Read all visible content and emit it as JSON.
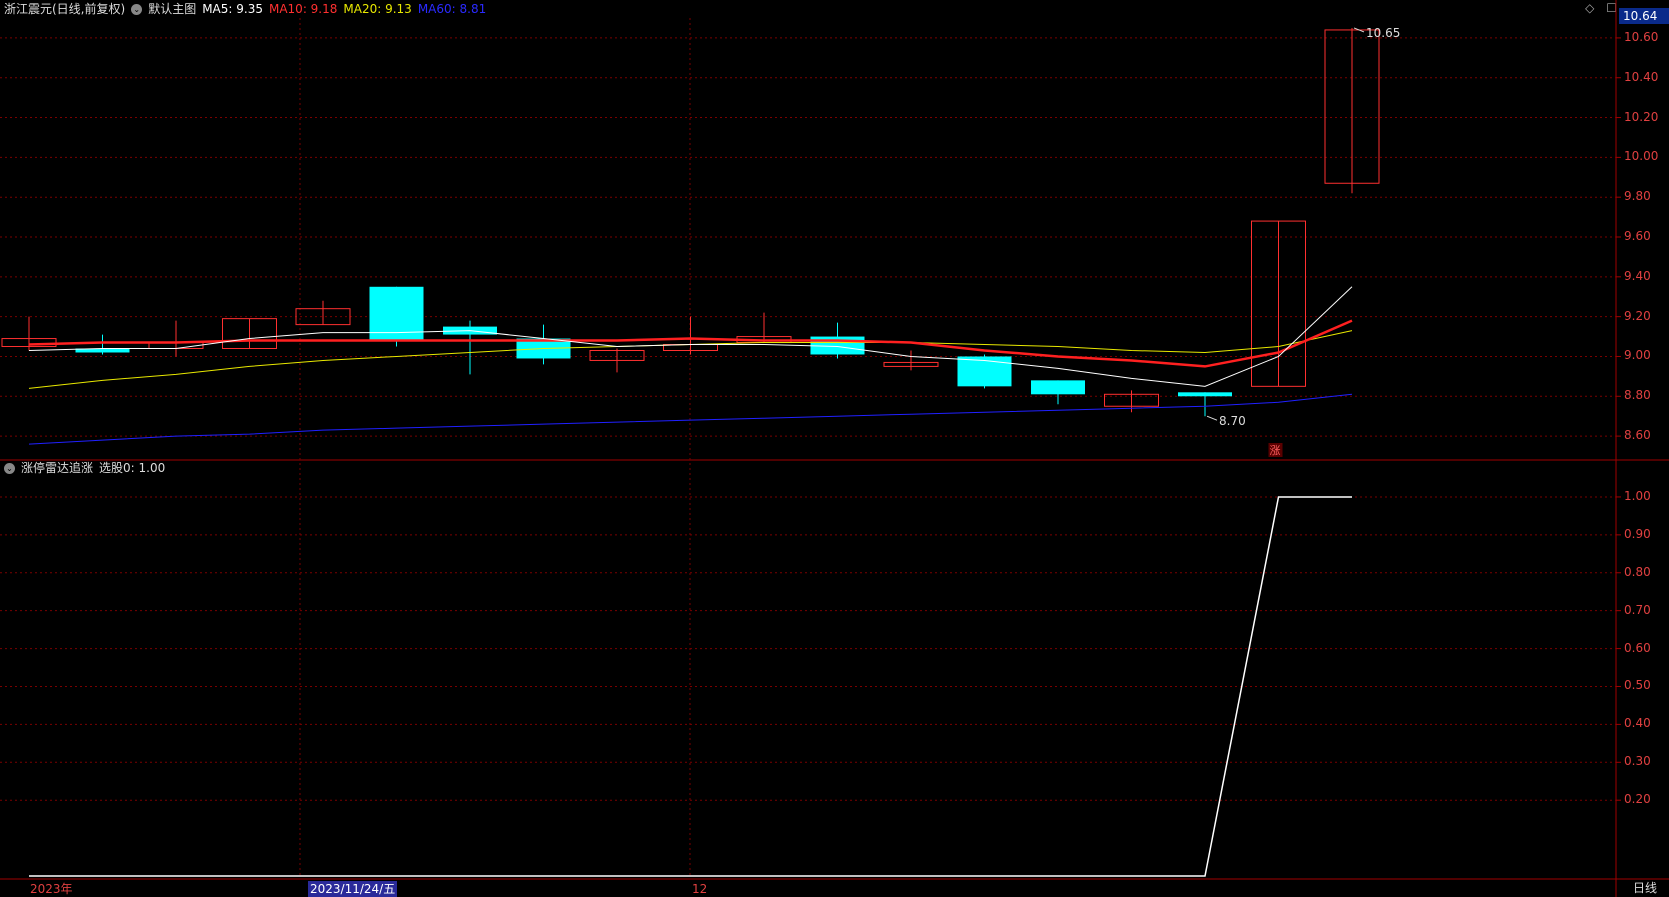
{
  "header": {
    "stock_title": "浙江震元(日线,前复权)",
    "main_chart_name": "默认主图",
    "ma5_label": "MA5: 9.35",
    "ma10_label": "MA10: 9.18",
    "ma20_label": "MA20: 9.13",
    "ma60_label": "MA60: 8.81",
    "icon_diamond": "◇",
    "icon_window": "☐"
  },
  "current_price": "10.64",
  "price_axis": {
    "ticks": [
      "10.60",
      "10.40",
      "10.20",
      "10.00",
      "9.80",
      "9.60",
      "9.40",
      "9.20",
      "9.00",
      "8.80",
      "8.60"
    ]
  },
  "annotations": {
    "high_label": "10.65",
    "low_label": "8.70",
    "limit_up_marker": "涨"
  },
  "indicator": {
    "title": "涨停雷达追涨",
    "value_label": "选股0: 1.00",
    "ticks": [
      "1.00",
      "0.90",
      "0.80",
      "0.70",
      "0.60",
      "0.50",
      "0.40",
      "0.30",
      "0.20"
    ]
  },
  "bottom": {
    "year_label": "2023年",
    "cursor_date": "2023/11/24/五",
    "month_label": "12",
    "period_button": "日线"
  },
  "colors": {
    "up": "#ff3030",
    "down": "#00ffff",
    "ma5": "#ffffff",
    "ma10": "#ff2020",
    "ma20": "#e8e800",
    "ma60": "#2020ff",
    "grid": "#7a0000",
    "axis_text": "#e04040"
  },
  "chart_data": {
    "type": "candlestick",
    "series": [
      {
        "open": 9.05,
        "high": 9.2,
        "low": 9.03,
        "close": 9.09
      },
      {
        "open": 9.04,
        "high": 9.11,
        "low": 9.01,
        "close": 9.02
      },
      {
        "open": 9.04,
        "high": 9.18,
        "low": 9.0,
        "close": 9.07
      },
      {
        "open": 9.04,
        "high": 9.19,
        "low": 9.04,
        "close": 9.19
      },
      {
        "open": 9.16,
        "high": 9.28,
        "low": 9.16,
        "close": 9.24
      },
      {
        "open": 9.35,
        "high": 9.35,
        "low": 9.05,
        "close": 9.08
      },
      {
        "open": 9.15,
        "high": 9.18,
        "low": 8.91,
        "close": 9.11
      },
      {
        "open": 9.09,
        "high": 9.16,
        "low": 8.96,
        "close": 8.99
      },
      {
        "open": 8.98,
        "high": 9.04,
        "low": 8.92,
        "close": 9.03
      },
      {
        "open": 9.03,
        "high": 9.2,
        "low": 9.01,
        "close": 9.06
      },
      {
        "open": 9.07,
        "high": 9.22,
        "low": 9.07,
        "close": 9.1
      },
      {
        "open": 9.1,
        "high": 9.17,
        "low": 8.99,
        "close": 9.01
      },
      {
        "open": 8.95,
        "high": 9.03,
        "low": 8.93,
        "close": 8.97
      },
      {
        "open": 9.0,
        "high": 9.01,
        "low": 8.84,
        "close": 8.85
      },
      {
        "open": 8.88,
        "high": 8.88,
        "low": 8.76,
        "close": 8.81
      },
      {
        "open": 8.75,
        "high": 8.83,
        "low": 8.72,
        "close": 8.81
      },
      {
        "open": 8.82,
        "high": 8.82,
        "low": 8.7,
        "close": 8.8
      },
      {
        "open": 8.85,
        "high": 9.68,
        "low": 8.85,
        "close": 9.68
      },
      {
        "open": 9.87,
        "high": 10.65,
        "low": 9.82,
        "close": 10.64
      }
    ],
    "ma5": [
      9.03,
      9.04,
      9.04,
      9.09,
      9.12,
      9.12,
      9.13,
      9.09,
      9.05,
      9.06,
      9.06,
      9.05,
      9.0,
      8.98,
      8.94,
      8.89,
      8.85,
      9.0,
      9.35
    ],
    "ma10": [
      9.06,
      9.07,
      9.07,
      9.08,
      9.08,
      9.08,
      9.08,
      9.08,
      9.08,
      9.09,
      9.08,
      9.08,
      9.07,
      9.03,
      9.0,
      8.98,
      8.95,
      9.02,
      9.18
    ],
    "ma20": [
      8.84,
      8.88,
      8.91,
      8.95,
      8.98,
      9.0,
      9.02,
      9.04,
      9.05,
      9.06,
      9.07,
      9.07,
      9.07,
      9.06,
      9.05,
      9.03,
      9.02,
      9.05,
      9.13
    ],
    "ma60": [
      8.56,
      8.58,
      8.6,
      8.61,
      8.63,
      8.64,
      8.65,
      8.66,
      8.67,
      8.68,
      8.69,
      8.7,
      8.71,
      8.72,
      8.73,
      8.74,
      8.75,
      8.77,
      8.81
    ],
    "indicator_values": [
      0,
      0,
      0,
      0,
      0,
      0,
      0,
      0,
      0,
      0,
      0,
      0,
      0,
      0,
      0,
      0,
      0,
      1,
      1
    ],
    "price_ylim": [
      8.48,
      10.7
    ],
    "indicator_ylim": [
      0,
      1.05
    ]
  }
}
